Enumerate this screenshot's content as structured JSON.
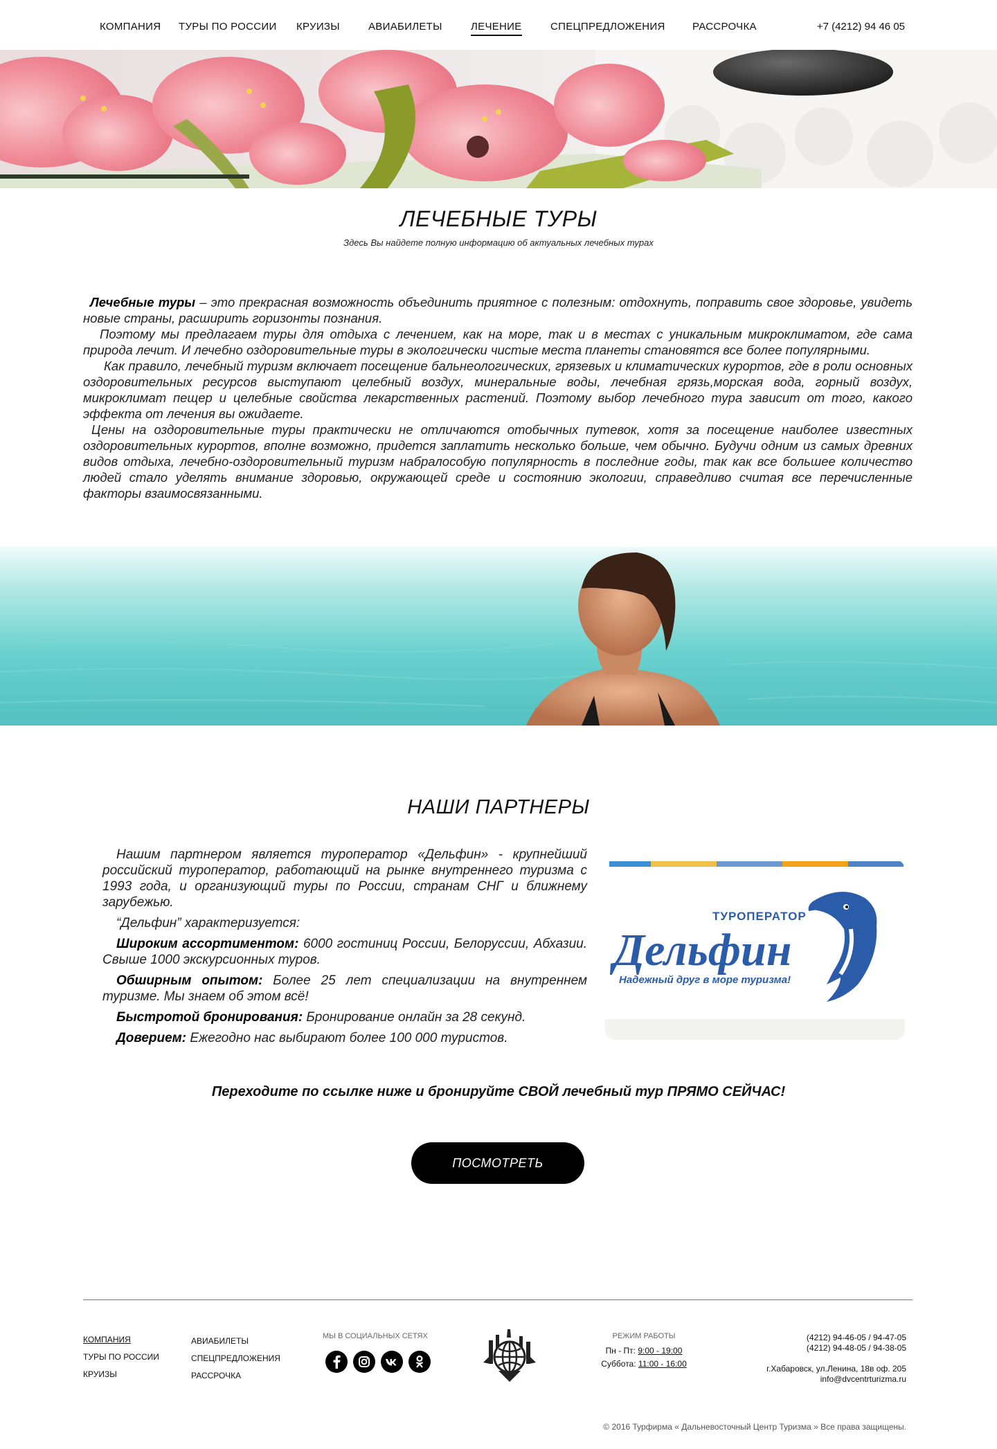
{
  "nav": {
    "items": [
      "КОМПАНИЯ",
      "ТУРЫ ПО РОССИИ",
      "КРУИЗЫ",
      "АВИАБИЛЕТЫ",
      "ЛЕЧЕНИЕ",
      "СПЕЦПРЕДЛОЖЕНИЯ",
      "РАССРОЧКА"
    ],
    "active": "ЛЕЧЕНИЕ",
    "phone": "+7 (4212) 94 46 05"
  },
  "intro": {
    "title": "ЛЕЧЕБНЫЕ ТУРЫ",
    "subtitle": "Здесь Вы найдете полную информацию об актуальных лечебных турах",
    "p1_bold": "Лечебные туры",
    "p1_rest": " – это прекрасная возможность объединить приятное с полезным: отдохнуть, поправить свое здоровье, увидеть новые страны, расширить горизонты познания.",
    "p2": "Поэтому мы предлагаем туры для отдыха с лечением, как на море, так и в местах с уникальным микроклиматом, где сама природа лечит. И лечебно оздоровительные туры в экологически чистые места планеты становятся все более популярными.",
    "p3": "Как правило, лечебный туризм включает посещение бальнеологических, грязевых и климатических курортов, где в роли основных оздоровительных ресурсов выступают целебный воздух, минеральные воды, лечебная грязь,морская вода, горный воздух, микроклимат пещер и целебные свойства лекарственных растений.  Поэтому выбор лечебного тура зависит от того, какого эффекта от лечения вы ожидаете.",
    "p4": "Цены на оздоровительные туры практически не отличаются отобычных путевок, хотя за посещение наиболее известных оздоровительных курортов, вполне возможно, придется заплатить несколько больше, чем обычно. Будучи одним из самых древних видов отдыха, лечебно-оздоровительный туризм набралособую популярность в последние годы, так как все большее количество людей стало уделять внимание здоровью, окружающей среде и состоянию экологии, справедливо считая все перечисленные факторы взаимосвязанными."
  },
  "partners": {
    "title": "НАШИ ПАРТНЕРЫ",
    "p1": "Нашим партнером является туроператор «Дельфин» - крупнейший российский туроператор, работающий на рынке внутреннего туризма с 1993 года, и организующий туры по России, странам СНГ и ближнему зарубежью.",
    "p2": "“Дельфин” характеризуется:",
    "f1_bold": "Широким ассортиментом:",
    "f1": " 6000 гостиниц России, Белоруссии, Абхазии. Свыше 1000 экскурсионных туров.",
    "f2_bold": "Обширным опытом:",
    "f2": " Более 25 лет специализации на внутреннем туризме. Мы знаем об этом всё!",
    "f3_bold": "Быстротой бронирования:",
    "f3": " Бронирование онлайн за 28 секунд.",
    "f4_bold": "Доверием:",
    "f4": "  Ежегодно нас выбирают более 100 000 туристов.",
    "logo_top": "ТУРОПЕРАТОР",
    "logo_name": "Дельфин",
    "logo_slogan": "Надежный друг в море туризма!"
  },
  "cta": {
    "text": "Переходите по ссылке ниже и бронируйте СВОЙ лечебный тур ПРЯМО СЕЙЧАС!",
    "button": "ПОСМОТРЕТЬ"
  },
  "footer": {
    "col1": [
      "КОМПАНИЯ",
      "ТУРЫ ПО РОССИИ",
      "КРУИЗЫ"
    ],
    "col2": [
      "АВИАБИЛЕТЫ",
      "СПЕЦПРЕДЛОЖЕНИЯ",
      "РАССРОЧКА"
    ],
    "social_title": "МЫ В СОЦИАЛЬНЫХ СЕТЯХ",
    "social": [
      "facebook-icon",
      "instagram-icon",
      "vk-icon",
      "odnoklassniki-icon"
    ],
    "hours_title": "РЕЖИМ РАБОТЫ",
    "weekdays_label": "Пн - Пт: ",
    "weekdays_time": "9:00 - 19:00",
    "saturday_label": "Суббота: ",
    "saturday_time": "11:00 - 16:00",
    "phone1": "(4212) 94-46-05 / 94-47-05",
    "phone2": "(4212) 94-48-05 / 94-38-05",
    "address": "г.Хабаровск, ул.Ленина, 18в оф. 205",
    "email": "info@dvcentrturizma.ru",
    "copyright": "© 2016 Турфирма « Дальневосточный Центр Туризма » Все права защищены."
  },
  "colors": {
    "accent": "#000000",
    "sea": "#3fc2c0",
    "logo_blue": "#2a5caa"
  }
}
